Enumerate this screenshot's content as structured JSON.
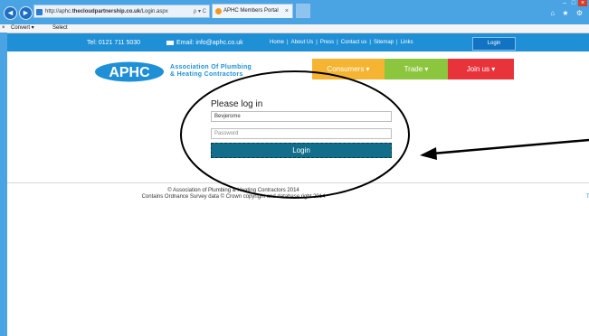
{
  "browser": {
    "url_prefix": "http://aphc.",
    "url_host": "thecloudpartnership.co.uk",
    "url_path": "/Login.aspx",
    "url_tools": "ρ ▾ C",
    "tab_title": "APHC Members Portal",
    "tab_close": "×",
    "cmd_close": "×",
    "convert_label": "Convert ▾",
    "select_label": "Select",
    "win_min": "–",
    "win_max": "□",
    "win_close": "×",
    "tools_icons": "⌂ ★ ⚙",
    "back": "◄",
    "forward": "►"
  },
  "header": {
    "phone": "Tel: 0121 711 5030",
    "email": "Email: info@aphc.co.uk",
    "links": [
      "Home",
      "About Us",
      "Press",
      "Contact us",
      "Sitemap",
      "Links"
    ],
    "sep": "|",
    "login_label": "Login"
  },
  "logo": {
    "mark": "APHC",
    "line1": "Association Of Plumbing",
    "line2": "& Heating Contractors"
  },
  "menu": {
    "consumers": "Consumers  ▾",
    "trade": "Trade  ▾",
    "join": "Join us  ▾"
  },
  "login": {
    "heading": "Please log in",
    "username_value": "Bevjerome",
    "password_placeholder": "Password",
    "button": "Login"
  },
  "footer": {
    "line1": "© Association of Plumbing & Heating Contractors 2014",
    "line2": "Contains Ordnance Survey data © Crown copyright and database right 2014",
    "t": "T"
  },
  "colors": {
    "chrome": "#4aa3e3",
    "topbar": "#1f8fd6",
    "consumers": "#f5b431",
    "trade": "#8cc63f",
    "join": "#e8333b",
    "login_button": "#126e8b"
  }
}
